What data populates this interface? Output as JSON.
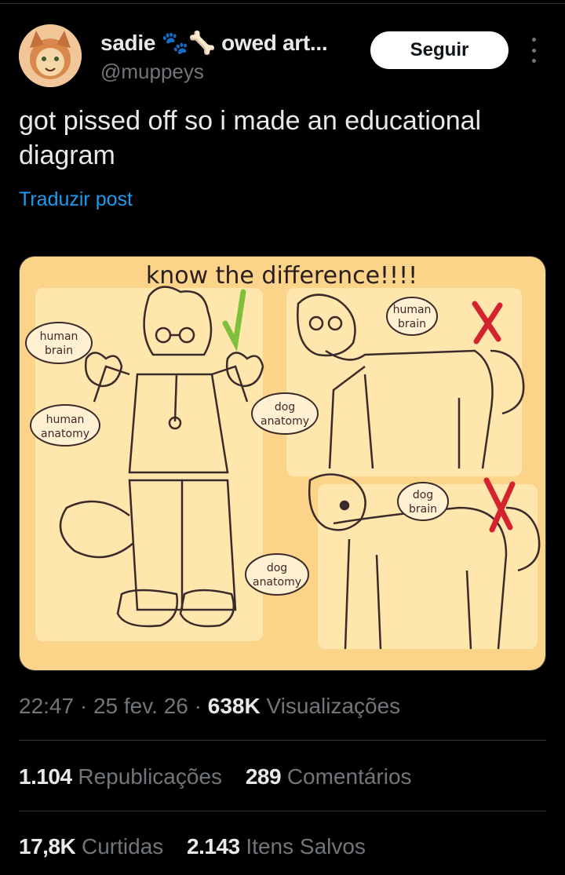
{
  "author": {
    "display_name": "sadie 🐾🦴 owed art...",
    "handle": "@muppeys"
  },
  "follow_label": "Seguir",
  "more_icon": "more-vertical-icon",
  "post": {
    "text": "got pissed off so i made an educational diagram",
    "translate_label": "Traduzir post"
  },
  "image": {
    "title": "know the difference!!!!",
    "labels": {
      "human_brain_1": [
        "human",
        "brain"
      ],
      "human_anatomy": [
        "human",
        "anatomy"
      ],
      "dog_anatomy_1": [
        "dog",
        "anatomy"
      ],
      "human_brain_2": [
        "human",
        "brain"
      ],
      "dog_brain": [
        "dog",
        "brain"
      ],
      "dog_anatomy_2": [
        "dog",
        "anatomy"
      ]
    },
    "colors": {
      "background": "#fbd48a",
      "panel": "#ffe6ad",
      "check": "#7fc03a",
      "cross": "#d4222e",
      "line": "#3b2a2a"
    }
  },
  "meta": {
    "time": "22:47",
    "date": "25 fev. 26",
    "views_count": "638K",
    "views_label": "Visualizações"
  },
  "stats": {
    "reposts_count": "1.104",
    "reposts_label": "Republicações",
    "comments_count": "289",
    "comments_label": "Comentários",
    "likes_count": "17,8K",
    "likes_label": "Curtidas",
    "saves_count": "2.143",
    "saves_label": "Itens Salvos"
  }
}
